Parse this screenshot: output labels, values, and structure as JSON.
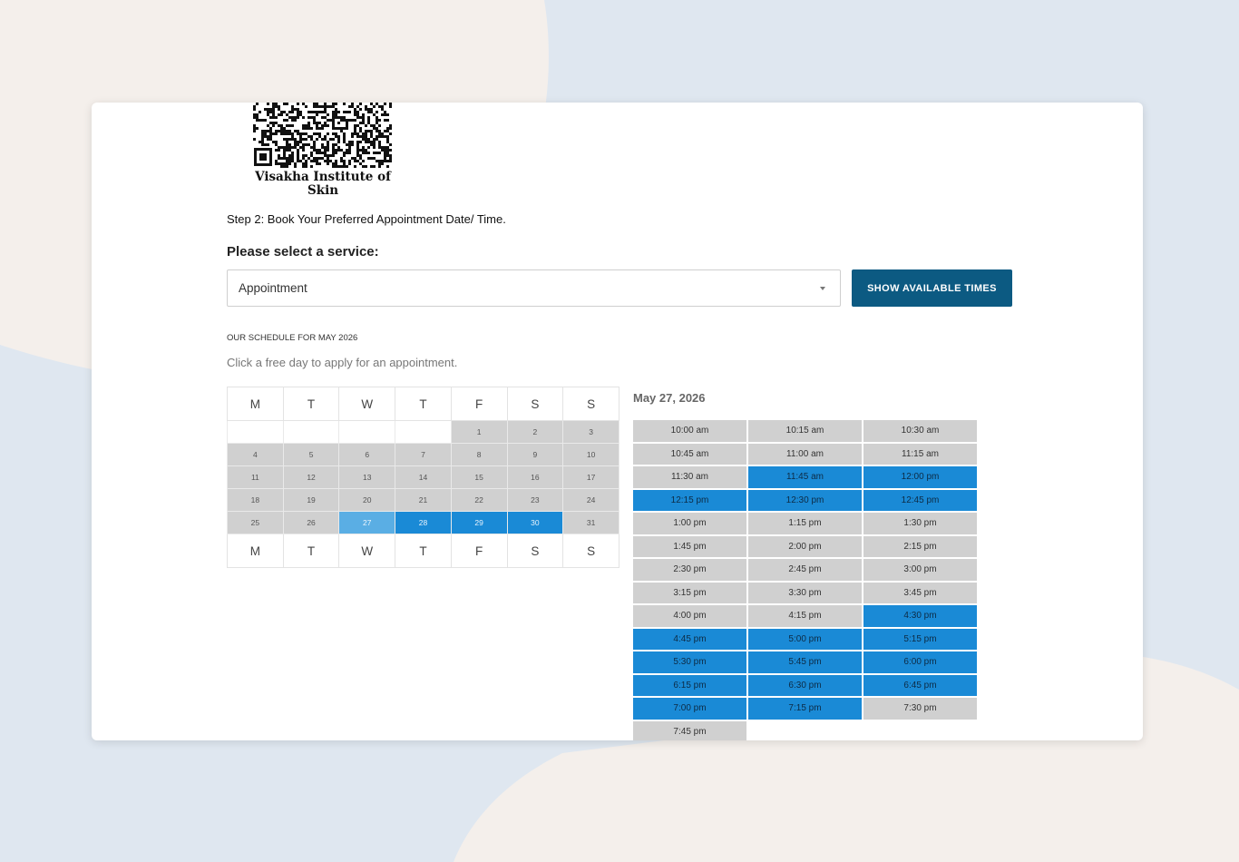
{
  "clinic": {
    "name": "Visakha Institute of Skin"
  },
  "booking": {
    "step_title": "Step 2: Book Your Preferred Appointment Date/ Time.",
    "service_label": "Please select a service:",
    "service_value": "Appointment",
    "show_times_label": "SHOW AVAILABLE TIMES",
    "schedule_heading": "OUR SCHEDULE FOR MAY 2026",
    "instruction": "Click a free day to apply for an appointment."
  },
  "calendar": {
    "weekdays": [
      "M",
      "T",
      "W",
      "T",
      "F",
      "S",
      "S"
    ],
    "weeks": [
      [
        {
          "d": ""
        },
        {
          "d": ""
        },
        {
          "d": ""
        },
        {
          "d": ""
        },
        {
          "d": "1",
          "s": "busy"
        },
        {
          "d": "2",
          "s": "busy"
        },
        {
          "d": "3",
          "s": "busy"
        }
      ],
      [
        {
          "d": "4",
          "s": "busy"
        },
        {
          "d": "5",
          "s": "busy"
        },
        {
          "d": "6",
          "s": "busy"
        },
        {
          "d": "7",
          "s": "busy"
        },
        {
          "d": "8",
          "s": "busy"
        },
        {
          "d": "9",
          "s": "busy"
        },
        {
          "d": "10",
          "s": "busy"
        }
      ],
      [
        {
          "d": "11",
          "s": "busy"
        },
        {
          "d": "12",
          "s": "busy"
        },
        {
          "d": "13",
          "s": "busy"
        },
        {
          "d": "14",
          "s": "busy"
        },
        {
          "d": "15",
          "s": "busy"
        },
        {
          "d": "16",
          "s": "busy"
        },
        {
          "d": "17",
          "s": "busy"
        }
      ],
      [
        {
          "d": "18",
          "s": "busy"
        },
        {
          "d": "19",
          "s": "busy"
        },
        {
          "d": "20",
          "s": "busy"
        },
        {
          "d": "21",
          "s": "busy"
        },
        {
          "d": "22",
          "s": "busy"
        },
        {
          "d": "23",
          "s": "busy"
        },
        {
          "d": "24",
          "s": "busy"
        }
      ],
      [
        {
          "d": "25",
          "s": "busy"
        },
        {
          "d": "26",
          "s": "busy"
        },
        {
          "d": "27",
          "s": "sel"
        },
        {
          "d": "28",
          "s": "avail"
        },
        {
          "d": "29",
          "s": "avail"
        },
        {
          "d": "30",
          "s": "avail"
        },
        {
          "d": "31",
          "s": "busy"
        }
      ]
    ]
  },
  "slots": {
    "date": "May 27, 2026",
    "times": [
      {
        "t": "10:00 am",
        "a": false
      },
      {
        "t": "10:15 am",
        "a": false
      },
      {
        "t": "10:30 am",
        "a": false
      },
      {
        "t": "10:45 am",
        "a": false
      },
      {
        "t": "11:00 am",
        "a": false
      },
      {
        "t": "11:15 am",
        "a": false
      },
      {
        "t": "11:30 am",
        "a": false
      },
      {
        "t": "11:45 am",
        "a": true
      },
      {
        "t": "12:00 pm",
        "a": true
      },
      {
        "t": "12:15 pm",
        "a": true
      },
      {
        "t": "12:30 pm",
        "a": true
      },
      {
        "t": "12:45 pm",
        "a": true
      },
      {
        "t": "1:00 pm",
        "a": false
      },
      {
        "t": "1:15 pm",
        "a": false
      },
      {
        "t": "1:30 pm",
        "a": false
      },
      {
        "t": "1:45 pm",
        "a": false
      },
      {
        "t": "2:00 pm",
        "a": false
      },
      {
        "t": "2:15 pm",
        "a": false
      },
      {
        "t": "2:30 pm",
        "a": false
      },
      {
        "t": "2:45 pm",
        "a": false
      },
      {
        "t": "3:00 pm",
        "a": false
      },
      {
        "t": "3:15 pm",
        "a": false
      },
      {
        "t": "3:30 pm",
        "a": false
      },
      {
        "t": "3:45 pm",
        "a": false
      },
      {
        "t": "4:00 pm",
        "a": false
      },
      {
        "t": "4:15 pm",
        "a": false
      },
      {
        "t": "4:30 pm",
        "a": true
      },
      {
        "t": "4:45 pm",
        "a": true
      },
      {
        "t": "5:00 pm",
        "a": true
      },
      {
        "t": "5:15 pm",
        "a": true
      },
      {
        "t": "5:30 pm",
        "a": true
      },
      {
        "t": "5:45 pm",
        "a": true
      },
      {
        "t": "6:00 pm",
        "a": true
      },
      {
        "t": "6:15 pm",
        "a": true
      },
      {
        "t": "6:30 pm",
        "a": true
      },
      {
        "t": "6:45 pm",
        "a": true
      },
      {
        "t": "7:00 pm",
        "a": true
      },
      {
        "t": "7:15 pm",
        "a": true
      },
      {
        "t": "7:30 pm",
        "a": false
      },
      {
        "t": "7:45 pm",
        "a": false
      }
    ]
  },
  "colors": {
    "primary_button": "#0c5a82",
    "available": "#1a8ad6",
    "selected_day": "#5aaee4",
    "unavailable": "#d0d0d0"
  }
}
